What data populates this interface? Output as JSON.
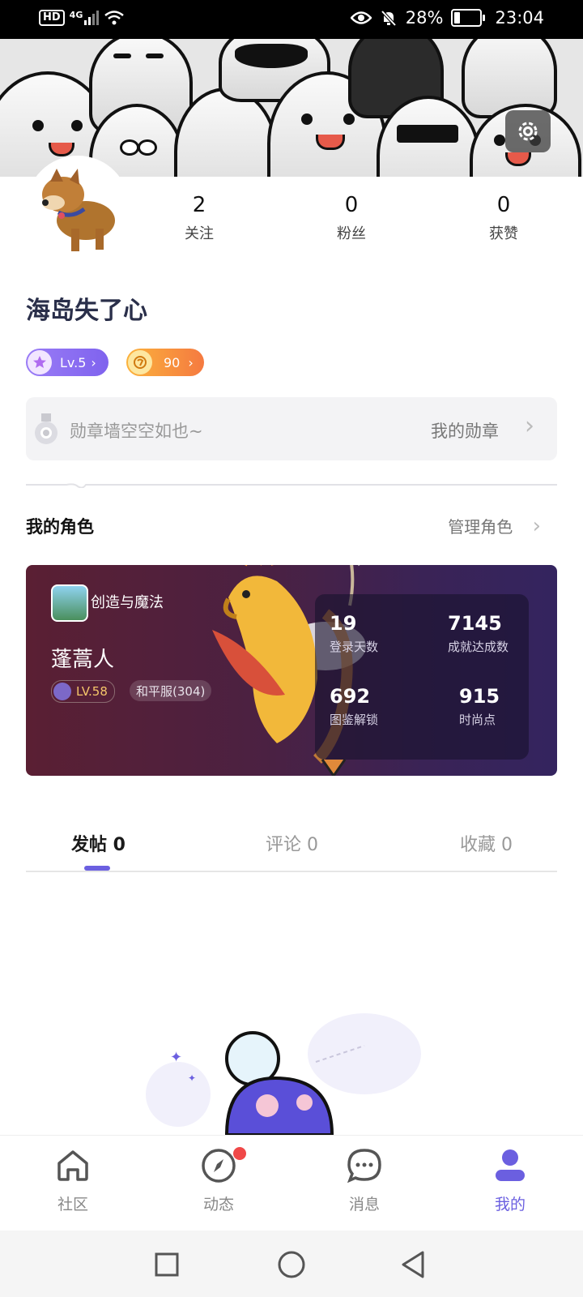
{
  "status_bar": {
    "network": "HD",
    "signal_type": "4G",
    "battery_percent": "28%",
    "time": "23:04",
    "icons": [
      "eye-icon",
      "bell-off-icon",
      "battery-icon",
      "wifi-icon",
      "signal-icon"
    ]
  },
  "profile": {
    "username": "海岛失了心",
    "stats": [
      {
        "value": "2",
        "label": "关注"
      },
      {
        "value": "0",
        "label": "粉丝"
      },
      {
        "value": "0",
        "label": "获赞"
      }
    ],
    "level_badge": "Lv.5",
    "coin_badge": "90"
  },
  "medal_wall": {
    "empty_text": "勋章墙空空如也~",
    "link_label": "我的勋章"
  },
  "roles_section": {
    "title": "我的角色",
    "manage_label": "管理角色",
    "card": {
      "game_name": "创造与魔法",
      "role_name": "蓬蒿人",
      "level": "LV.58",
      "server": "和平服(304)",
      "stats": [
        {
          "value": "19",
          "label": "登录天数"
        },
        {
          "value": "7145",
          "label": "成就达成数"
        },
        {
          "value": "692",
          "label": "图鉴解锁"
        },
        {
          "value": "915",
          "label": "时尚点"
        }
      ]
    }
  },
  "content_tabs": [
    {
      "label": "发帖 0",
      "active": true
    },
    {
      "label": "评论 0",
      "active": false
    },
    {
      "label": "收藏 0",
      "active": false
    }
  ],
  "bottom_nav": [
    {
      "label": "社区",
      "icon": "house-icon",
      "active": false
    },
    {
      "label": "动态",
      "icon": "compass-icon",
      "active": false,
      "badge": true
    },
    {
      "label": "消息",
      "icon": "chat-bubble-icon",
      "active": false
    },
    {
      "label": "我的",
      "icon": "person-icon",
      "active": true
    }
  ],
  "colors": {
    "accent": "#6b5fe0",
    "level_pill": "#8a6cf0",
    "coin_pill": "#f5843c",
    "notification_dot": "#f04848"
  }
}
